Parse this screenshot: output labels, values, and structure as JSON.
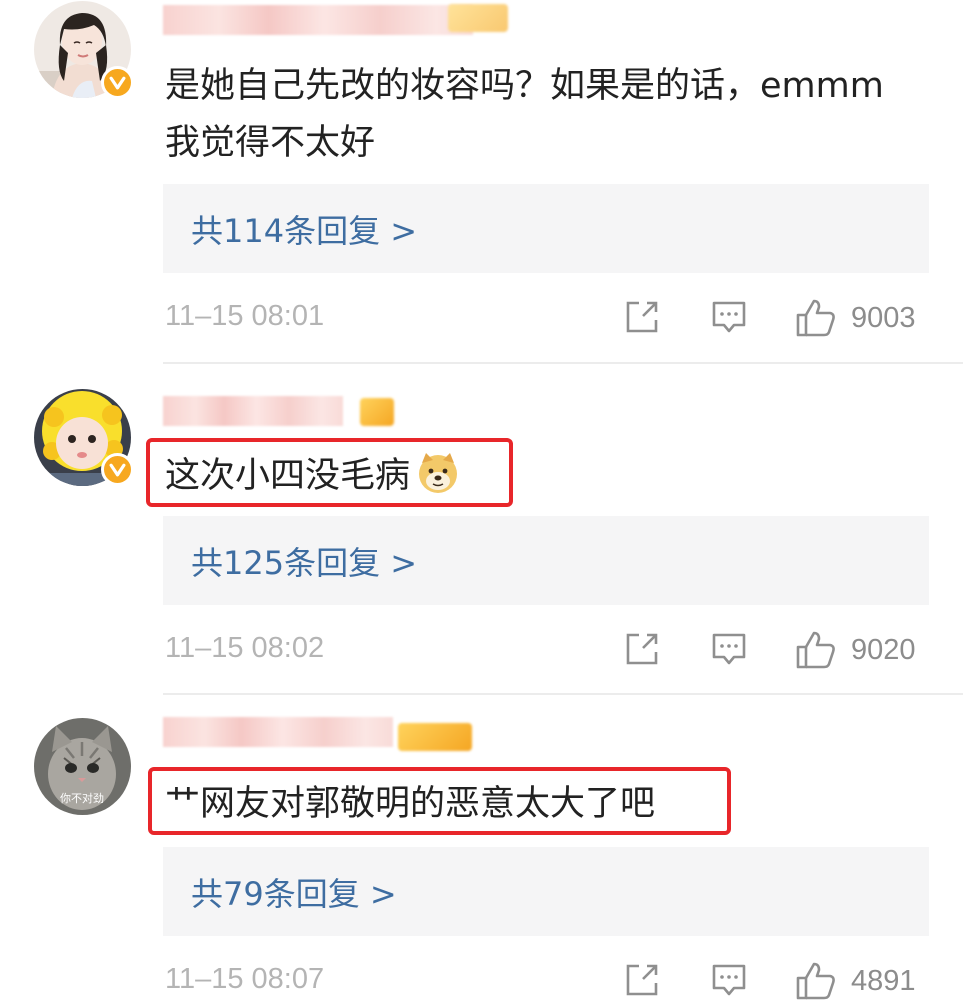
{
  "comments": [
    {
      "text": "是她自己先改的妆容吗？如果是的话，emmm我觉得不太好",
      "replies_label": "共114条回复 >",
      "timestamp": "11–15 08:01",
      "likes": "9003",
      "verified": true,
      "highlighted": false
    },
    {
      "text": "这次小四没毛病",
      "replies_label": "共125条回复 >",
      "timestamp": "11–15 08:02",
      "likes": "9020",
      "verified": true,
      "highlighted": true,
      "emoji": "doge-icon"
    },
    {
      "text": "艹网友对郭敬明的恶意太大了吧",
      "replies_label": "共79条回复 >",
      "timestamp": "11–15 08:07",
      "likes": "4891",
      "verified": false,
      "highlighted": true,
      "avatar_caption": "你不对劲"
    }
  ],
  "colors": {
    "link": "#3e6da1",
    "highlight": "#e8262a",
    "verified": "#f7a81f",
    "reply_panel": "#f5f5f6"
  }
}
